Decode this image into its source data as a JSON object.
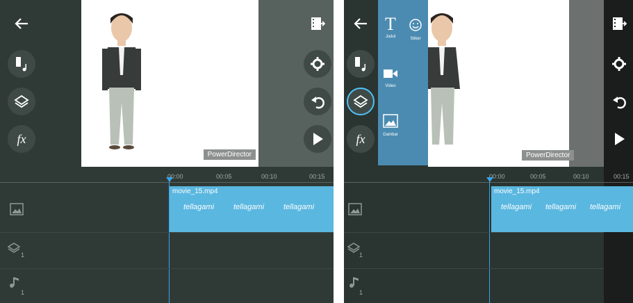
{
  "left_panel": {
    "watermark": "PowerDirector",
    "toolbar_left": [
      "back-arrow-icon",
      "media-music-icon",
      "layers-icon",
      "fx-icon"
    ],
    "fx_label": "fx",
    "toolbar_right": [
      "export-film-icon",
      "settings-gear-icon",
      "undo-icon",
      "play-icon"
    ],
    "ruler_ticks": [
      "00:00",
      "00:05",
      "00:10",
      "00:15"
    ],
    "clip": {
      "filename": "movie_15.mp4",
      "thumbnails": [
        "tellagami",
        "tellagami",
        "tellagami"
      ]
    },
    "track_counts": {
      "layer": "1",
      "audio": "1"
    }
  },
  "right_panel": {
    "watermark": "PowerDirector",
    "menu": [
      {
        "label": "Judul",
        "icon": "text-T-icon"
      },
      {
        "label": "Stiker",
        "icon": "smiley-icon"
      },
      {
        "label": "Video",
        "icon": "video-camera-icon"
      },
      {
        "label": "Gambar",
        "icon": "image-icon"
      }
    ],
    "fx_label": "fx",
    "ruler_ticks": [
      "00:00",
      "00:05",
      "00:10",
      "00:15"
    ],
    "clip": {
      "filename": "movie_15.mp4",
      "thumbnails": [
        "tellagami",
        "tellagami",
        "tellagami"
      ]
    },
    "track_counts": {
      "layer": "1",
      "audio": "1"
    }
  },
  "colors": {
    "panel_bg": "#2f3a37",
    "accent_blue": "#3aa3e6",
    "clip_blue": "#5ab7e0",
    "menu_blue": "#4b8bb1"
  }
}
